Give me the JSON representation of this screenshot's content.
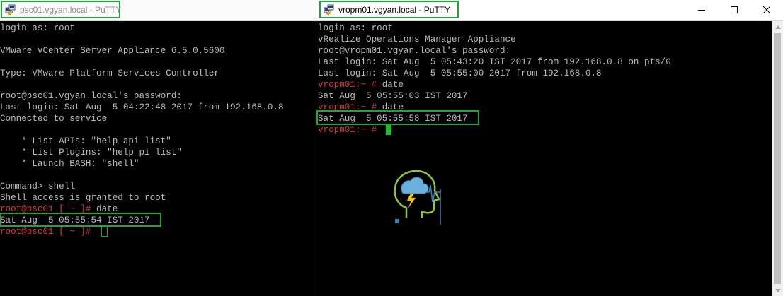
{
  "left_window": {
    "title": "psc01.vgyan.local - PuTTY",
    "lines": [
      {
        "text": "login as: root"
      },
      {
        "text": ""
      },
      {
        "text": "VMware vCenter Server Appliance 6.5.0.5600"
      },
      {
        "text": ""
      },
      {
        "text": "Type: VMware Platform Services Controller"
      },
      {
        "text": ""
      },
      {
        "text": "root@psc01.vgyan.local's password:"
      },
      {
        "text": "Last login: Sat Aug  5 04:22:48 2017 from 192.168.0.8"
      },
      {
        "text": "Connected to service"
      },
      {
        "text": ""
      },
      {
        "text": "    * List APIs: \"help api list\""
      },
      {
        "text": "    * List Plugins: \"help pi list\""
      },
      {
        "text": "    * Launch BASH: \"shell\""
      },
      {
        "text": ""
      },
      {
        "text": "Command> shell"
      },
      {
        "text": "Shell access is granted to root"
      },
      {
        "prompt": "root@psc01 [ ~ ]# ",
        "text": "date"
      },
      {
        "text": "Sat Aug  5 05:55:54 IST 2017"
      },
      {
        "prompt": "root@psc01 [ ~ ]# ",
        "text": ""
      }
    ]
  },
  "right_window": {
    "title": "vropm01.vgyan.local - PuTTY",
    "lines": [
      {
        "text": "login as: root"
      },
      {
        "text": "vRealize Operations Manager Appliance"
      },
      {
        "text": "root@vropm01.vgyan.local's password:"
      },
      {
        "text": "Last login: Sat Aug  5 05:43:20 IST 2017 from 192.168.0.8 on pts/0"
      },
      {
        "text": "Last login: Sat Aug  5 05:55:00 2017 from 192.168.0.8"
      },
      {
        "prompt": "vropm01:~ # ",
        "text": "date"
      },
      {
        "text": "Sat Aug  5 05:55:03 IST 2017"
      },
      {
        "prompt": "vropm01:~ # ",
        "text": "date"
      },
      {
        "text": "Sat Aug  5 05:55:58 IST 2017"
      },
      {
        "prompt": "vropm01:~ # ",
        "text": ""
      }
    ]
  },
  "colors": {
    "terminal_fg": "#bbbbbb",
    "prompt": "#d23c3c",
    "highlight": "#1fa63a",
    "cursor": "#19c22d"
  },
  "icons": {
    "title_icon": "putty-icon",
    "controls": [
      "minimize-icon",
      "maximize-icon",
      "close-icon"
    ],
    "watermark": "vgyan-logo-icon"
  }
}
